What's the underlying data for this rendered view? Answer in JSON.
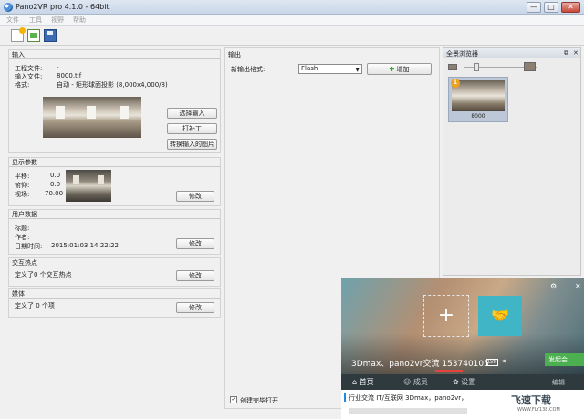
{
  "window": {
    "title": "Pano2VR pro 4.1.0 - 64bit",
    "minimize": "—",
    "maximize": "□",
    "close": "✕"
  },
  "menu": [
    "文件",
    "工具",
    "视野",
    "帮助"
  ],
  "toolbar": {
    "icons": [
      "new-project-icon",
      "open-project-icon",
      "save-project-icon"
    ]
  },
  "input_panel": {
    "title": "输入",
    "project_file_label": "工程文件:",
    "project_file_value": "-",
    "input_file_label": "输入文件:",
    "input_file_value": "8000.tif",
    "format_label": "格式:",
    "format_value": "自动 - 矩形球面投影 (8,000x4,000/8)",
    "select_input_button": "选择输入",
    "patch_button": "打补丁",
    "convert_button": "转换输入的图片"
  },
  "display_panel": {
    "title": "显示参数",
    "pan_label": "平移:",
    "pan_value": "0.0",
    "tilt_label": "俯仰:",
    "tilt_value": "0.0",
    "fov_label": "视场:",
    "fov_value": "70.00",
    "modify_button": "修改"
  },
  "user_data_panel": {
    "title": "用户数据",
    "title_label": "标题:",
    "author_label": "作者:",
    "datetime_label": "日期时间:",
    "datetime_value": "2015:01:03 14:22:22",
    "modify_button": "修改"
  },
  "hotspot_panel": {
    "title": "交互热点",
    "summary": "定义了0 个交互热点",
    "modify_button": "修改"
  },
  "media_panel": {
    "title": "媒体",
    "summary": "定义了 0 个项",
    "modify_button": "修改"
  },
  "output_panel": {
    "title": "输出",
    "format_label": "新输出格式:",
    "format_selected": "Flash",
    "add_button": "增加",
    "open_after_label": "创建完毕打开",
    "open_after_checked": "✓"
  },
  "browser_panel": {
    "title": "全景浏览器",
    "float_icon": "⧉",
    "close_icon": "✕",
    "item_badge": "1",
    "item_label": "8000"
  },
  "video_overlay": {
    "corner_left": "⚙",
    "corner_right": "✕",
    "plus": "+",
    "hands": "🤝",
    "title": "3Dmax、pano2vr交流 153740105",
    "level_badge": "LV8",
    "share_icon": "⋖",
    "green_button": "发起会",
    "nav": [
      "首页",
      "成员",
      "设置"
    ],
    "nav_right": "编辑",
    "bottom_text": "行业交流  IT/互联网  3Dmax，pano2vr，"
  },
  "watermark": {
    "logo": "飞速下载",
    "url": "WWW.FLY138.COM"
  }
}
